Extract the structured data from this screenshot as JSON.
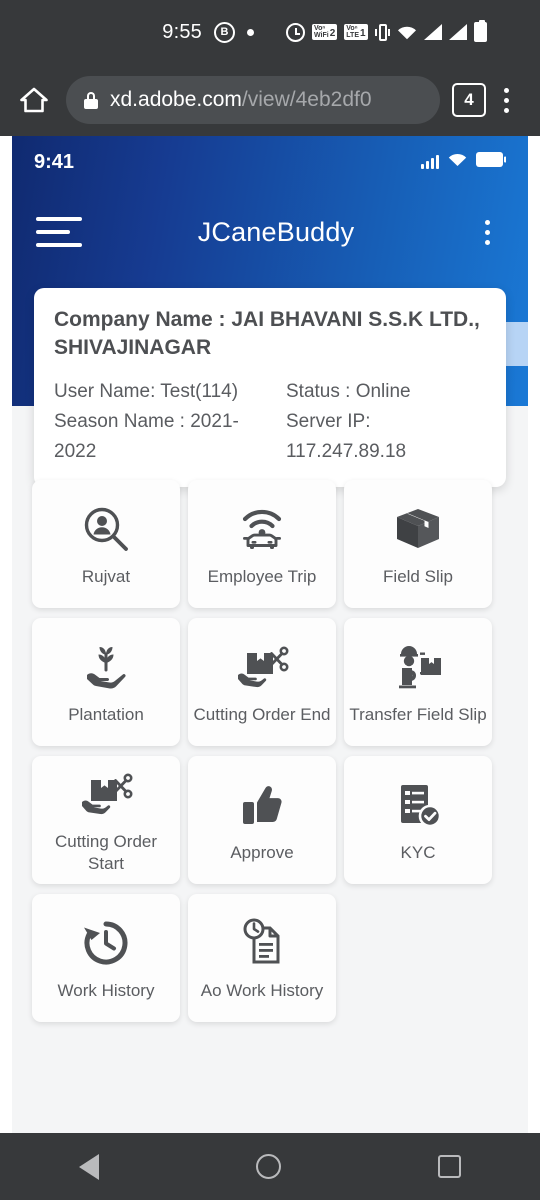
{
  "phone_status_bar": {
    "time": "9:55",
    "bubble_letter": "B",
    "icons": [
      "alarm-icon",
      "vowifi-icon",
      "volte-icon",
      "vibrate-icon",
      "wifi-icon",
      "signal-icon",
      "signal-icon",
      "battery-icon"
    ],
    "vowifi_label_top": "Voⁿ",
    "vowifi_label_bottom": "WiFi",
    "vowifi_sim": "2",
    "volte_label_top": "Voⁿ",
    "volte_label_bottom": "LTE",
    "volte_sim": "1"
  },
  "browser": {
    "home_icon": "home-icon",
    "lock_icon": "lock-icon",
    "url_host": "xd.adobe.com",
    "url_path": "/view/4eb2df0",
    "tab_count": "4",
    "menu_icon": "overflow-menu-icon"
  },
  "app": {
    "status_time": "9:41",
    "title": "JCaneBuddy",
    "menu_icon": "hamburger-menu-icon",
    "overflow_icon": "overflow-menu-icon",
    "header_gradient_start": "#102a70",
    "header_gradient_end": "#1a79d6",
    "accent_color": "#b7d4f5"
  },
  "info_card": {
    "company": "Company Name : JAI BHAVANI S.S.K LTD., SHIVAJINAGAR",
    "rows": [
      {
        "left": "User Name: Test(114)",
        "right": "Status : Online"
      },
      {
        "left": "Season Name : 2021- 2022",
        "right": "Server IP: 117.247.89.18"
      }
    ]
  },
  "grid": {
    "tiles": [
      {
        "label": "Rujvat",
        "icon": "person-search-icon"
      },
      {
        "label": "Employee Trip",
        "icon": "connected-car-icon"
      },
      {
        "label": "Field Slip",
        "icon": "box-icon"
      },
      {
        "label": "Plantation",
        "icon": "hand-sprout-icon"
      },
      {
        "label": "Cutting Order End",
        "icon": "hand-box-scissors-icon"
      },
      {
        "label": "Transfer Field Slip",
        "icon": "worker-box-icon"
      },
      {
        "label": "Cutting Order Start",
        "icon": "hand-box-scissors-icon"
      },
      {
        "label": "Approve",
        "icon": "thumbs-up-icon"
      },
      {
        "label": "KYC",
        "icon": "checklist-verified-icon"
      },
      {
        "label": "Work History",
        "icon": "history-clock-icon"
      },
      {
        "label": "Ao Work History",
        "icon": "document-clock-icon"
      }
    ]
  },
  "nav_bar": {
    "back": "back-icon",
    "home": "home-circle-icon",
    "recents": "recents-square-icon"
  }
}
